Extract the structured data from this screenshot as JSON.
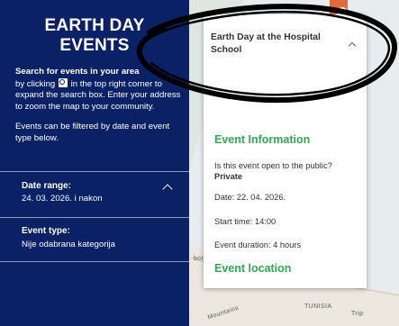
{
  "sidebar": {
    "title_line1": "EARTH DAY",
    "title_line2": "EVENTS",
    "search_heading": "Search for events in your area",
    "search_text_pre": "by clicking",
    "search_text_post": "in the top right corner to expand the search box. Enter your address to zoom the map to your community.",
    "filter_note": "Events can be filtered by date and event type below.",
    "date_range_label": "Date range:",
    "date_range_value": "24. 03. 2026. i nakon",
    "event_type_label": "Event type:",
    "event_type_value": "Nije odabrana kategorija"
  },
  "popup": {
    "title": "Earth Day at the Hospital School",
    "section_info": "Event Information",
    "question": "Is this event open to the public?",
    "answer": "Private",
    "date": "Date: 22. 04. 2026.",
    "start_time": "Start time: 14:00",
    "duration": "Event duration: 4 hours",
    "section_location": "Event location"
  },
  "map": {
    "label_mountains": "Mountains",
    "label_tunisia": "TUNISIA",
    "label_tripoli": "Trip",
    "label_bor": "bor"
  },
  "colors": {
    "sidebar_bg": "#0a2165",
    "section_green": "#32a852",
    "edge_orange": "#e3683c"
  },
  "icons": {
    "search": "magnifier-icon",
    "collapse": "chevron-up-icon"
  }
}
